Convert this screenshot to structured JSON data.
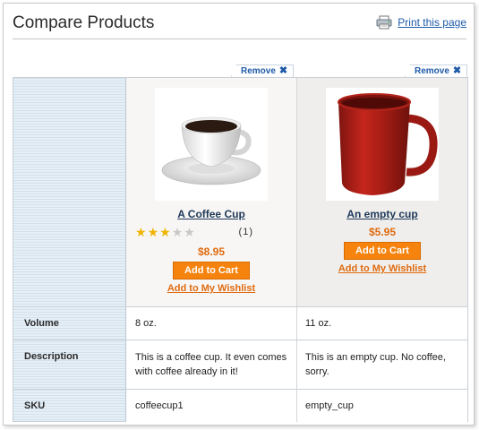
{
  "header": {
    "title": "Compare Products",
    "print_label": "Print this page"
  },
  "remove_label": "Remove",
  "products": [
    {
      "name": "A Coffee Cup",
      "rating_stars": 3,
      "rating_max": 5,
      "review_count": "(1)",
      "price": "$8.95",
      "add_to_cart": "Add to Cart",
      "wishlist": "Add to My Wishlist",
      "volume": "8 oz.",
      "description": "This is a coffee cup. It even comes with coffee already in it!",
      "sku": "coffeecup1"
    },
    {
      "name": "An empty cup",
      "price": "$5.95",
      "add_to_cart": "Add to Cart",
      "wishlist": "Add to My Wishlist",
      "volume": "11 oz.",
      "description": "This is an empty cup. No coffee, sorry.",
      "sku": "empty_cup"
    }
  ],
  "attributes": {
    "volume_label": "Volume",
    "description_label": "Description",
    "sku_label": "SKU"
  },
  "icons": {
    "print": "printer-icon",
    "remove": "close-icon",
    "rating": "star-icon"
  },
  "colors": {
    "link_blue": "#1e5aa8",
    "price_orange": "#e06b10",
    "button_orange": "#f5830e",
    "label_column": "#dbe7f0"
  }
}
